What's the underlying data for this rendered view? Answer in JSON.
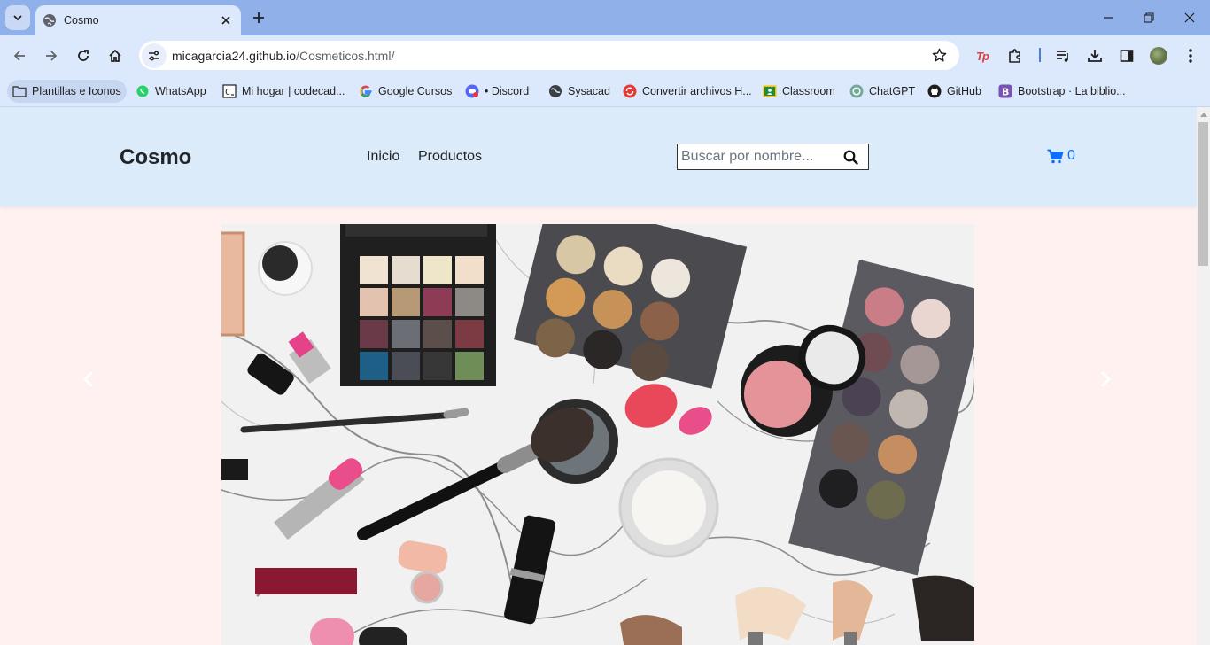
{
  "browser": {
    "tab_title": "Cosmo",
    "url_host": "micagarcia24.github.io",
    "url_path": "/Cosmeticos.html/",
    "bookmarks": [
      {
        "label": "Plantillas e Iconos",
        "icon": "folder-icon"
      },
      {
        "label": "WhatsApp",
        "icon": "whatsapp-icon"
      },
      {
        "label": "Mi hogar | codecad...",
        "icon": "codecademy-icon"
      },
      {
        "label": "Google Cursos",
        "icon": "google-icon"
      },
      {
        "label": "• Discord",
        "icon": "discord-icon"
      },
      {
        "label": "Sysacad",
        "icon": "globe-icon"
      },
      {
        "label": "Convertir archivos H...",
        "icon": "convert-icon"
      },
      {
        "label": "Classroom",
        "icon": "classroom-icon"
      },
      {
        "label": "ChatGPT",
        "icon": "chatgpt-icon"
      },
      {
        "label": "GitHub",
        "icon": "github-icon"
      },
      {
        "label": "Bootstrap · La biblio...",
        "icon": "bootstrap-icon"
      }
    ],
    "extension_badge": "Tp"
  },
  "site": {
    "brand": "Cosmo",
    "nav": {
      "home": "Inicio",
      "products": "Productos"
    },
    "search": {
      "placeholder": "Buscar por nombre..."
    },
    "cart_count": "0"
  },
  "colors": {
    "tabstrip": "#8fb0e8",
    "toolbar": "#dce8fb",
    "header_bg": "#dcebf9",
    "page_bg": "#fff1f0",
    "cart_accent": "#0d6efd"
  }
}
